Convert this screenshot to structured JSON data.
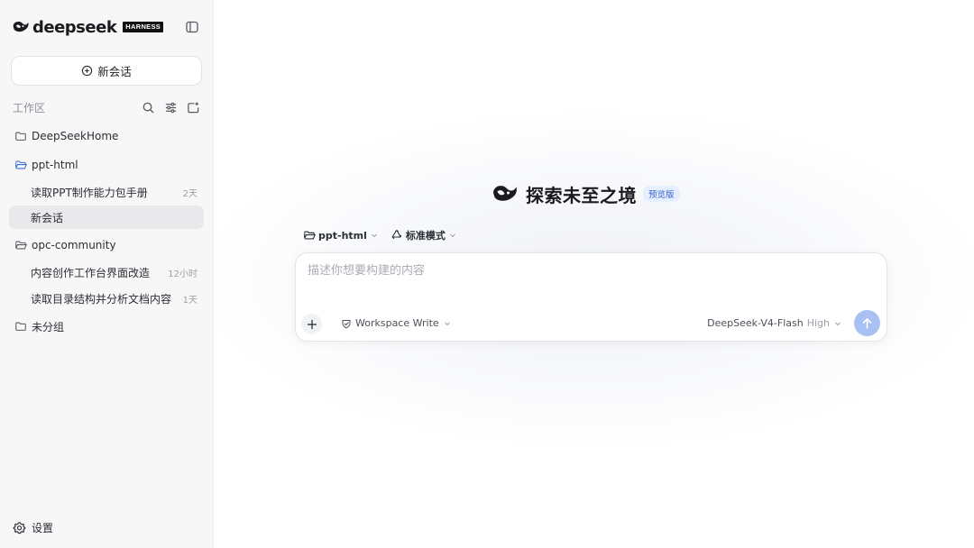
{
  "brand": {
    "name": "deepseek",
    "badge": "HARNESS"
  },
  "sidebar": {
    "new_chat_label": "新会话",
    "workspace_label": "工作区",
    "tree": [
      {
        "kind": "folder",
        "label": "DeepSeekHome",
        "icon": "folder-icon"
      },
      {
        "kind": "folder",
        "label": "ppt-html",
        "icon": "folder-open-icon",
        "accent": "#3b6fd8"
      },
      {
        "kind": "chat",
        "label": "读取PPT制作能力包手册",
        "age": "2天"
      },
      {
        "kind": "chat",
        "label": "新会话",
        "age": "",
        "active": true
      },
      {
        "kind": "folder",
        "label": "opc-community",
        "icon": "folder-open-icon"
      },
      {
        "kind": "chat",
        "label": "内容创作工作台界面改造",
        "age": "12小时"
      },
      {
        "kind": "chat",
        "label": "读取目录结构并分析文档内容",
        "age": "1天"
      },
      {
        "kind": "folder",
        "label": "未分组",
        "icon": "folder-icon"
      }
    ],
    "settings_label": "设置"
  },
  "main": {
    "hero_title": "探索未至之境",
    "hero_badge": "预览版",
    "context": {
      "project_label": "ppt-html",
      "mode_label": "标准模式"
    },
    "composer": {
      "placeholder": "描述你想要构建的内容",
      "value": "",
      "permission_label": "Workspace Write",
      "model_label": "DeepSeek-V4-Flash",
      "effort_label": "High"
    }
  },
  "colors": {
    "accent": "#3b6fd8",
    "send_button": "#a9c0f3",
    "sidebar_bg": "#f7f7f8",
    "active_item_bg": "#e9e9eb"
  }
}
